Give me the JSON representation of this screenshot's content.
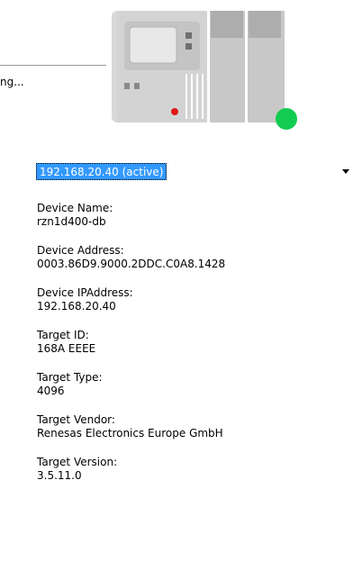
{
  "status": {
    "text": "ng..."
  },
  "device": {
    "status_color": "#12cc52"
  },
  "selector": {
    "value": "192.168.20.40 (active)"
  },
  "fields": {
    "device_name": {
      "label": "Device Name:",
      "value": "rzn1d400-db"
    },
    "device_address": {
      "label": "Device Address:",
      "value": "0003.86D9.9000.2DDC.C0A8.1428"
    },
    "device_ip": {
      "label": "Device IPAddress:",
      "value": "192.168.20.40"
    },
    "target_id": {
      "label": "Target ID:",
      "value": "168A  EEEE"
    },
    "target_type": {
      "label": "Target Type:",
      "value": "4096"
    },
    "target_vendor": {
      "label": "Target Vendor:",
      "value": "Renesas Electronics Europe GmbH"
    },
    "target_version": {
      "label": "Target Version:",
      "value": "3.5.11.0"
    }
  }
}
